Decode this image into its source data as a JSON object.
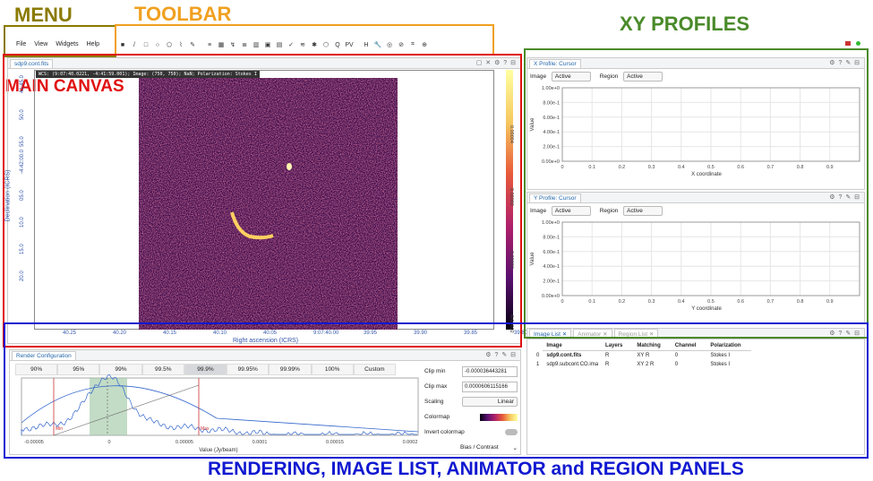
{
  "labels": {
    "menu": "MENU",
    "toolbar": "TOOLBAR",
    "xy": "XY PROFILES",
    "main": "MAIN CANVAS",
    "bottom": "RENDERING, IMAGE LIST, ANIMATOR and REGION PANELS"
  },
  "colors": {
    "menu": "#8a7a00",
    "toolbar": "#f0a020",
    "xy": "#4a8a2a",
    "main": "#e01010",
    "bottom": "#1018d0"
  },
  "menu": [
    "File",
    "View",
    "Widgets",
    "Help"
  ],
  "toolbar_icons": [
    "■",
    "/",
    "□",
    "○",
    "⬠",
    "⌇",
    "✎",
    "≡",
    "▦",
    "↯",
    "≣",
    "▥",
    "▣",
    "▤",
    "✓",
    "≋",
    "✱",
    "⬡",
    "Q",
    "PV",
    "H",
    "🔧",
    "◎",
    "⊘",
    "⌗",
    "⊕"
  ],
  "canvas": {
    "tab": "sdp9.cont.fits",
    "cursor": "WCS: (9:07:40.0221, -4:41:59.001); Image: (750, 750); NaN; Polarization: Stokes I",
    "y_ticks": [
      "41:45.0",
      "50.0",
      "55.0",
      "-4:42:00.0",
      "05.0",
      "10.0",
      "15.0",
      "20.0"
    ],
    "x_ticks": [
      "40.25",
      "40.20",
      "40.15",
      "40.10",
      "40.05",
      "9:07:40.00",
      "39.95",
      "39.90",
      "39.85",
      "39.80"
    ],
    "x_label": "Right ascension (ICRS)",
    "y_label": "Declination (ICRS)",
    "cbar_ticks": [
      "0.00004",
      "0.00002",
      "0.00000",
      "-0.00002"
    ]
  },
  "xprof": {
    "tab": "X Profile: Cursor",
    "image_label": "Image",
    "image_val": "Active",
    "region_label": "Region",
    "region_val": "Active",
    "yticks": [
      "1.00e+0",
      "8.00e-1",
      "6.00e-1",
      "4.00e-1",
      "2.00e-1",
      "0.00e+0"
    ],
    "xticks": [
      "0",
      "0.1",
      "0.2",
      "0.3",
      "0.4",
      "0.5",
      "0.6",
      "0.7",
      "0.8",
      "0.9"
    ],
    "xlabel": "X coordinate",
    "ylabel": "Value"
  },
  "yprof": {
    "tab": "Y Profile: Cursor",
    "image_label": "Image",
    "image_val": "Active",
    "region_label": "Region",
    "region_val": "Active",
    "yticks": [
      "1.00e+0",
      "8.00e-1",
      "6.00e-1",
      "4.00e-1",
      "2.00e-1",
      "0.00e+0"
    ],
    "xticks": [
      "0",
      "0.1",
      "0.2",
      "0.3",
      "0.4",
      "0.5",
      "0.6",
      "0.7",
      "0.8",
      "0.9"
    ],
    "xlabel": "Y coordinate",
    "ylabel": "Value"
  },
  "render": {
    "tab": "Render Configuration",
    "pcts": [
      "90%",
      "95%",
      "99%",
      "99.5%",
      "99.9%",
      "99.95%",
      "99.99%",
      "100%",
      "Custom"
    ],
    "clip_min_label": "Clip min",
    "clip_min": "-0.000036443281",
    "clip_max_label": "Clip max",
    "clip_max": "0.0000606115166",
    "scaling_label": "Scaling",
    "scaling": "Linear",
    "colormap_label": "Colormap",
    "invert_label": "Invert colormap",
    "bias_label": "Bias / Contrast",
    "hist_xticks": [
      "-0.00005",
      "0",
      "0.00005",
      "0.0001",
      "0.00015",
      "0.0002"
    ],
    "hist_xlabel": "Value (Jy/beam)",
    "min_mark": "Min",
    "max_mark": "Max"
  },
  "imagelist": {
    "tabs": [
      "Image List",
      "Animator",
      "Region List"
    ],
    "headers": [
      "Image",
      "Layers",
      "Matching",
      "Channel",
      "Polarization"
    ],
    "rows": [
      {
        "idx": "0",
        "image": "sdp9.cont.fits",
        "layers": "R",
        "matching": "XY R",
        "channel": "0",
        "pol": "Stokes I"
      },
      {
        "idx": "1",
        "image": "sdp9.subcont.CO.ima",
        "layers": "R",
        "matching": "XY 2 R",
        "channel": "0",
        "pol": "Stokes I"
      }
    ]
  }
}
